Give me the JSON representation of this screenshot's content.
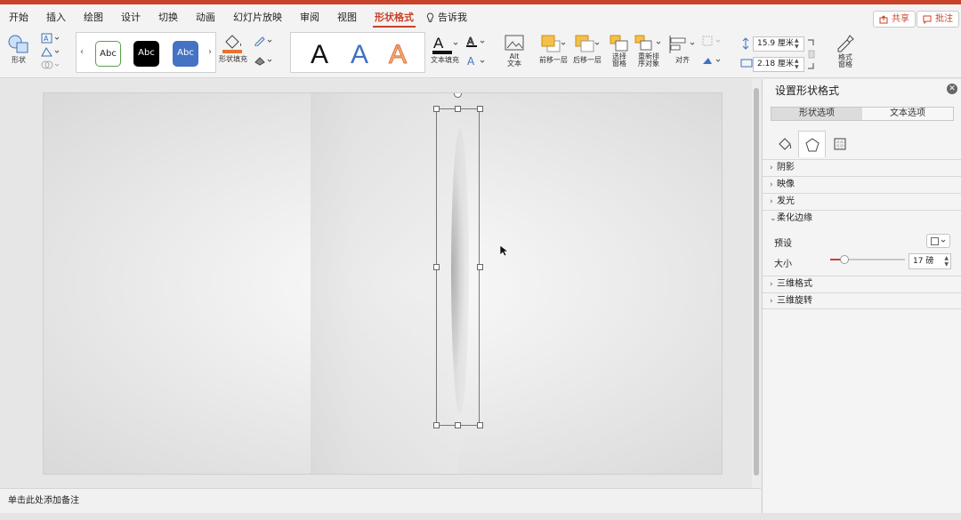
{
  "tabs": [
    {
      "label": "开始"
    },
    {
      "label": "插入"
    },
    {
      "label": "绘图"
    },
    {
      "label": "设计"
    },
    {
      "label": "切换"
    },
    {
      "label": "动画"
    },
    {
      "label": "幻灯片放映"
    },
    {
      "label": "审阅"
    },
    {
      "label": "视图"
    },
    {
      "label": "形状格式"
    }
  ],
  "active_tab": "形状格式",
  "tell_me": "告诉我",
  "share_label": "共享",
  "comment_label": "批注",
  "accent_color": "#c8432a",
  "ribbon": {
    "shape_label": "形状",
    "style_samples": [
      "Abc",
      "Abc",
      "Abc"
    ],
    "shape_fill_label": "形状填充",
    "wordart_letters": [
      "A",
      "A",
      "A"
    ],
    "text_fill_label": "文本填充",
    "alt_text_label": "Alt\n文本",
    "bring_forward_label": "前移一层",
    "send_backward_label": "后移一层",
    "selection_pane_label": "选择\n窗格",
    "reorder_label": "重新排\n序对象",
    "align_label": "对齐",
    "height_value": "15.9 厘米",
    "width_value": "2.18 厘米",
    "format_pane_label": "格式\n窗格"
  },
  "notes_placeholder": "单击此处添加备注",
  "pane": {
    "title": "设置形状格式",
    "seg_shape": "形状选项",
    "seg_text": "文本选项",
    "sections": {
      "shadow": "阴影",
      "reflection": "映像",
      "glow": "发光",
      "soft_edges": "柔化边缘",
      "three_d_format": "三维格式",
      "three_d_rotation": "三维旋转"
    },
    "preset_label": "预设",
    "size_label": "大小",
    "size_value": "17 磅",
    "soft_edge_slider_fraction": 0.19
  }
}
